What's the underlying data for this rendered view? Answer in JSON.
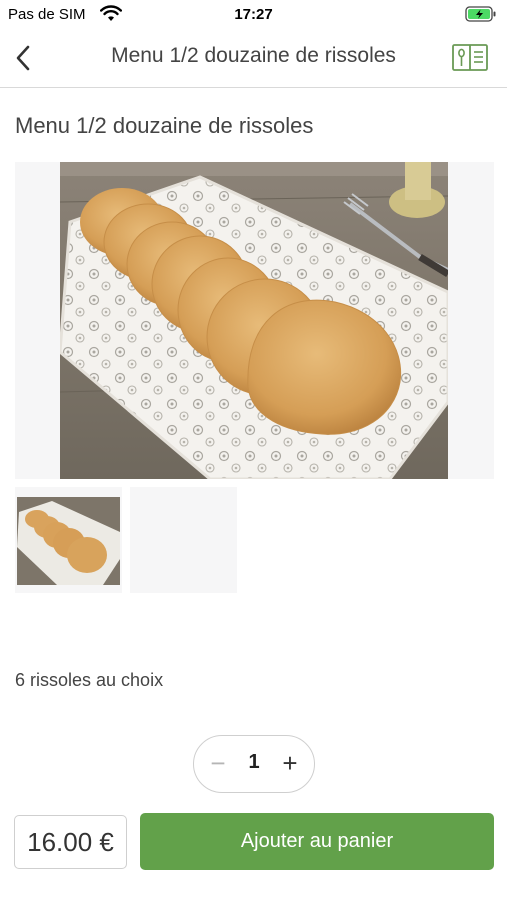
{
  "status_bar": {
    "carrier": "Pas de SIM",
    "time": "17:27",
    "wifi_icon": "wifi-icon",
    "battery_icon": "battery-charging-icon"
  },
  "nav": {
    "title": "Menu 1/2 douzaine de rissoles",
    "back_icon": "chevron-left-icon",
    "menu_icon": "menu-book-icon"
  },
  "product": {
    "title": "Menu 1/2 douzaine de rissoles",
    "description": "6 rissoles au choix",
    "quantity": "1",
    "minus_label": "−",
    "plus_label": "+",
    "price": "16.00 €",
    "add_button_label": "Ajouter au panier"
  },
  "colors": {
    "accent": "#62a14a",
    "menu_icon": "#6a9a55"
  }
}
